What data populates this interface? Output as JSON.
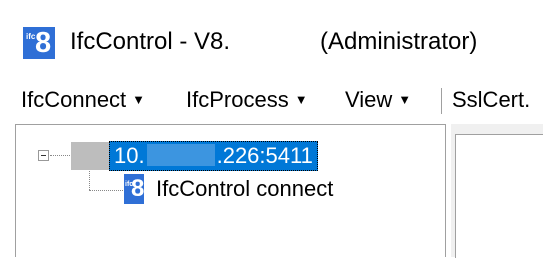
{
  "window": {
    "title": "IfcControl - V8.",
    "title_suffix": "(Administrator)",
    "icon": "ifc8-app-icon",
    "icon_small": "ifc",
    "icon_big": "8"
  },
  "menubar": {
    "items": [
      {
        "label": "IfcConnect",
        "caret": "▼"
      },
      {
        "label": "IfcProcess",
        "caret": "▼"
      },
      {
        "label": "View",
        "caret": "▼"
      },
      {
        "label": "SslCert."
      }
    ]
  },
  "tree": {
    "root": {
      "label_start": "10.",
      "label_end": ".226:5411",
      "selected": true,
      "icon": "server-icon"
    },
    "children": [
      {
        "label": "IfcControl connect",
        "icon": "ifc8-app-icon",
        "icon_small": "ifc",
        "icon_big": "8"
      }
    ]
  },
  "colors": {
    "selection": "#0078d7",
    "app_icon": "#2f6fd6"
  }
}
